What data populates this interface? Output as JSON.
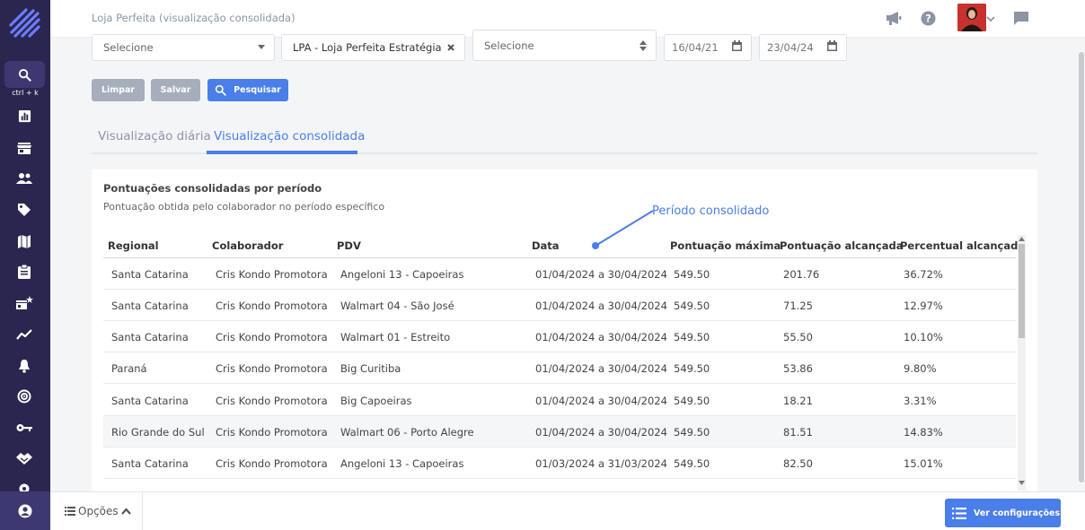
{
  "app": {
    "title": "Loja Perfeita (visualização consolidada)",
    "search_hint": "ctrl + k"
  },
  "sidebar": {
    "items": [
      {
        "icon": "search-icon"
      },
      {
        "icon": "bar-chart-icon"
      },
      {
        "icon": "store-icon"
      },
      {
        "icon": "users-icon"
      },
      {
        "icon": "tag-icon"
      },
      {
        "icon": "map-icon"
      },
      {
        "icon": "clipboard-icon"
      },
      {
        "icon": "store-star-icon"
      },
      {
        "icon": "trend-line-icon"
      },
      {
        "icon": "bell-icon"
      },
      {
        "icon": "target-icon"
      },
      {
        "icon": "key-icon"
      },
      {
        "icon": "handshake-icon"
      },
      {
        "icon": "gear-icon"
      }
    ],
    "user_icon": "user-circle-icon"
  },
  "filters": {
    "select1": "Selecione",
    "select2": "LPA - Loja Perfeita Estratégia",
    "select3": "Selecione",
    "date_start": "16/04/21",
    "date_end": "23/04/24"
  },
  "actions": {
    "clear": "Limpar",
    "save": "Salvar",
    "search": "Pesquisar"
  },
  "tabs": [
    {
      "label": "Visualização diária",
      "active": false
    },
    {
      "label": "Visualização consolidada",
      "active": true
    }
  ],
  "card": {
    "title": "Pontuações consolidadas por período",
    "subtitle": "Pontuação obtida pelo colaborador no período específico",
    "annotation": "Período consolidado"
  },
  "table": {
    "headers": [
      "Regional",
      "Colaborador",
      "PDV",
      "Data",
      "Pontuação máxima",
      "Pontuação alcançada",
      "Percentual alcançado"
    ],
    "rows": [
      [
        "Santa Catarina",
        "Cris Kondo Promotora",
        "Angeloni 13 - Capoeiras",
        "01/04/2024 a 30/04/2024",
        "549.50",
        "201.76",
        "36.72%"
      ],
      [
        "Santa Catarina",
        "Cris Kondo Promotora",
        "Walmart 04 - São José",
        "01/04/2024 a 30/04/2024",
        "549.50",
        "71.25",
        "12.97%"
      ],
      [
        "Santa Catarina",
        "Cris Kondo Promotora",
        "Walmart 01 - Estreito",
        "01/04/2024 a 30/04/2024",
        "549.50",
        "55.50",
        "10.10%"
      ],
      [
        "Paraná",
        "Cris Kondo Promotora",
        "Big Curitiba",
        "01/04/2024 a 30/04/2024",
        "549.50",
        "53.86",
        "9.80%"
      ],
      [
        "Santa Catarina",
        "Cris Kondo Promotora",
        "Big Capoeiras",
        "01/04/2024 a 30/04/2024",
        "549.50",
        "18.21",
        "3.31%"
      ],
      [
        "Rio Grande do Sul",
        "Cris Kondo Promotora",
        "Walmart 06 - Porto Alegre",
        "01/04/2024 a 30/04/2024",
        "549.50",
        "81.51",
        "14.83%"
      ],
      [
        "Santa Catarina",
        "Cris Kondo Promotora",
        "Angeloni 13 - Capoeiras",
        "01/03/2024 a 31/03/2024",
        "549.50",
        "82.50",
        "15.01%"
      ]
    ]
  },
  "footer": {
    "options_label": "Opções",
    "settings_button": "Ver configurações"
  },
  "colors": {
    "sidebar_bg": "#2a2650",
    "accent": "#4a7ee8",
    "muted_button": "#a6adbb"
  }
}
